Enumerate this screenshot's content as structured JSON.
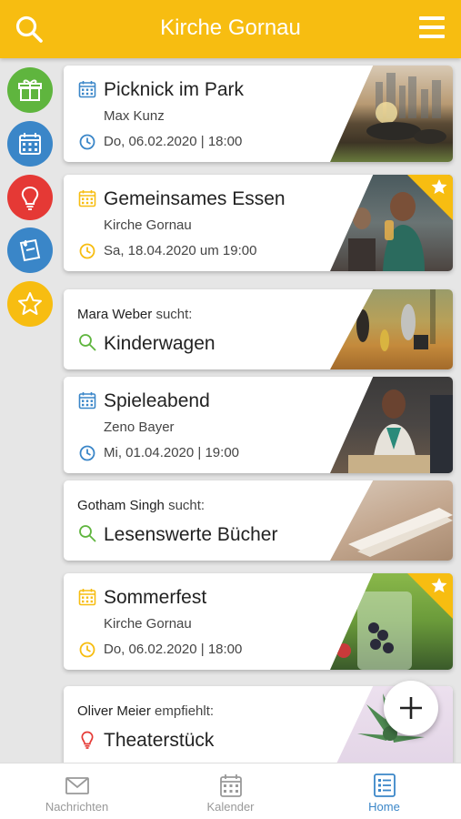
{
  "app": {
    "title": "Kirche Gornau",
    "colors": {
      "accent": "#f7bd11",
      "blue": "#3a86c8",
      "green": "#4caf50",
      "red": "#e53935"
    }
  },
  "sidebar": {
    "items": [
      {
        "name": "gift",
        "icon": "gift-icon",
        "color": "#5fb53e"
      },
      {
        "name": "calendar",
        "icon": "calendar-icon",
        "color": "#3a86c8"
      },
      {
        "name": "idea",
        "icon": "lightbulb-icon",
        "color": "#e53935"
      },
      {
        "name": "notes",
        "icon": "note-icon",
        "color": "#3a86c8"
      },
      {
        "name": "favorites",
        "icon": "star-icon",
        "color": "#f7bd11"
      }
    ]
  },
  "feed": [
    {
      "type": "event",
      "title": "Picknick im Park",
      "host": "Max Kunz",
      "date": "Do, 06.02.2020 | 18:00",
      "icon_color": "#3a86c8"
    },
    {
      "type": "event",
      "title": "Gemeinsames Essen",
      "host": "Kirche Gornau",
      "date": "Sa, 18.04.2020 um 19:00",
      "icon_color": "#f7bd11",
      "featured": true
    },
    {
      "type": "search",
      "user": "Mara Weber",
      "verb": "sucht:",
      "title": "Kinderwagen"
    },
    {
      "type": "event",
      "title": "Spieleabend",
      "host": "Zeno Bayer",
      "date": "Mi, 01.04.2020 | 19:00",
      "icon_color": "#3a86c8"
    },
    {
      "type": "search",
      "user": "Gotham Singh",
      "verb": "sucht:",
      "title": "Lesenswerte Bücher"
    },
    {
      "type": "event",
      "title": "Sommerfest",
      "host": "Kirche Gornau",
      "date": "Do, 06.02.2020 | 18:00",
      "icon_color": "#f7bd11",
      "featured": true
    },
    {
      "type": "recommend",
      "user": "Oliver Meier",
      "verb": "empfiehlt:",
      "title": "Theaterstück"
    }
  ],
  "bottom_nav": {
    "tabs": [
      {
        "label": "Nachrichten",
        "icon": "envelope-icon"
      },
      {
        "label": "Kalender",
        "icon": "calendar-icon"
      },
      {
        "label": "Home",
        "icon": "home-list-icon",
        "active": true
      }
    ]
  }
}
